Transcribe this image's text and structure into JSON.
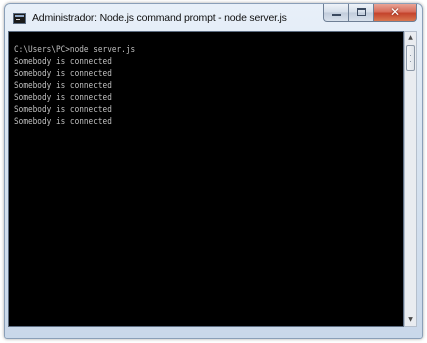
{
  "window": {
    "title": "Administrador: Node.js command prompt - node  server.js",
    "icon": "command-prompt-icon",
    "buttons": {
      "minimize_icon": "minimize-icon",
      "maximize_icon": "maximize-icon",
      "close_icon": "close-icon",
      "close_glyph": "✕",
      "close_color": "#c4432c"
    }
  },
  "console": {
    "background": "#000000",
    "text_color": "#c0c0c0",
    "lines": [
      "C:\\Users\\PC>node server.js",
      "Somebody is connected",
      "Somebody is connected",
      "Somebody is connected",
      "Somebody is connected",
      "Somebody is connected",
      "Somebody is connected"
    ]
  },
  "scrollbar": {
    "up_arrow": "▲",
    "down_arrow": "▼"
  }
}
